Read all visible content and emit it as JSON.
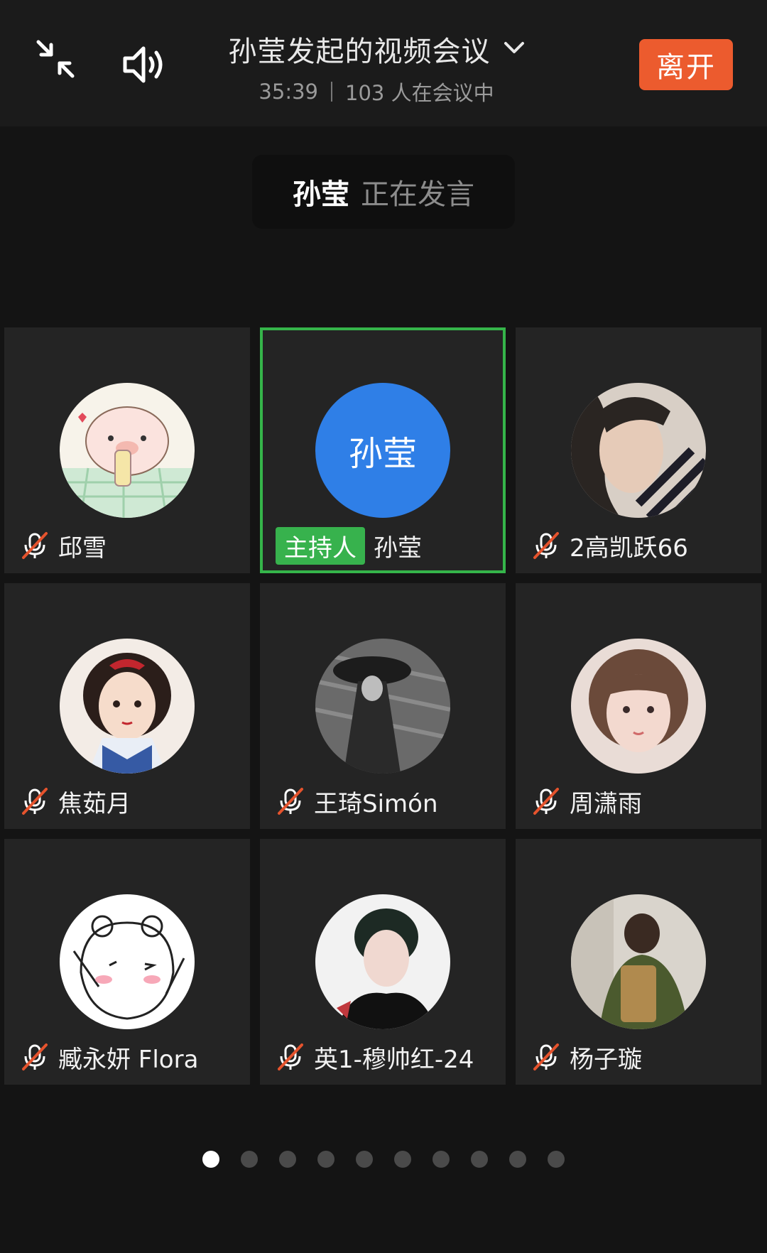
{
  "header": {
    "title": "孙莹发起的视频会议",
    "duration": "35:39",
    "participants": "103 人在会议中",
    "leave_label": "离开",
    "icons": [
      "shrink-icon",
      "speaker-icon",
      "chevron-down-icon"
    ]
  },
  "speaking": {
    "name": "孙莹",
    "status": "正在发言"
  },
  "participants": [
    {
      "name": "邱雪",
      "muted": true,
      "avatar": "cartoon-pig"
    },
    {
      "name": "孙莹",
      "host_label": "主持人",
      "muted": false,
      "avatar_text": "孙莹",
      "avatar_color": "#2f7fe7",
      "active_speaker": true
    },
    {
      "name": "2高凯跃66",
      "muted": true,
      "avatar": "photo-portrait"
    },
    {
      "name": "焦茹月",
      "muted": true,
      "avatar": "cartoon-princess"
    },
    {
      "name": "王琦Simón",
      "muted": true,
      "avatar": "photo-bw-figure"
    },
    {
      "name": "周潇雨",
      "muted": true,
      "avatar": "photo-girl"
    },
    {
      "name": "臧永妍 Flora",
      "muted": true,
      "avatar": "cartoon-sketch"
    },
    {
      "name": "英1-穆帅红-24",
      "muted": true,
      "avatar": "photo-woman-dark"
    },
    {
      "name": "杨子璇",
      "muted": true,
      "avatar": "photo-person-bag"
    }
  ],
  "pagination": {
    "pages": 10,
    "current": 1
  },
  "colors": {
    "accent": "#ec5b2e",
    "host": "#37b24d",
    "active_border": "#35b54a",
    "mute_slash": "#e5532d"
  }
}
